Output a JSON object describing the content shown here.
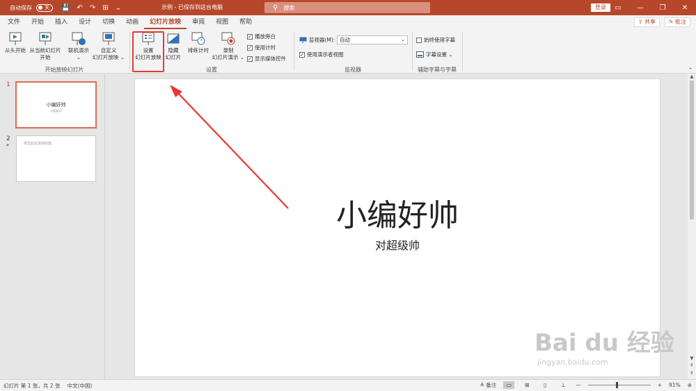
{
  "titlebar": {
    "autosave_label": "自动保存",
    "autosave_state": "关",
    "quick_access": [
      "💾",
      "↶",
      "↷",
      "⊞",
      "⌄"
    ],
    "doc_title": "示例 - 已保存到这台电脑",
    "search_placeholder": "搜索",
    "login_label": "登录",
    "window_controls": [
      "▭",
      "—",
      "❐",
      "✕"
    ],
    "accent_color": "#b7472a"
  },
  "menu": {
    "tabs": [
      "文件",
      "开始",
      "插入",
      "设计",
      "切换",
      "动画",
      "幻灯片放映",
      "审阅",
      "视图",
      "帮助"
    ],
    "active_tab": "幻灯片放映",
    "share_label": "共享",
    "comment_label": "批注"
  },
  "ribbon": {
    "start_group": {
      "label": "开始放映幻灯片",
      "from_beginning": "从头开始",
      "from_current_1": "从当前幻灯片",
      "from_current_2": "开始",
      "online_1": "联机演示",
      "online_2": "⌄",
      "custom_1": "自定义",
      "custom_2": "幻灯片放映 ⌄"
    },
    "setup_group": {
      "label": "设置",
      "setup_1": "设置",
      "setup_2": "幻灯片放映",
      "hide_1": "隐藏",
      "hide_2": "幻灯片",
      "rehearse": "排练计时",
      "record_1": "录制",
      "record_2": "幻灯片演示 ⌄",
      "play_narration": "播放旁白",
      "use_timings": "使用计时",
      "show_media": "显示媒体控件"
    },
    "monitor_group": {
      "label": "监视器",
      "monitor_label": "监视器(M):",
      "monitor_value": "自动",
      "presenter_view": "使用演示者视图"
    },
    "captions_group": {
      "label": "辅助字幕与字幕",
      "always_captions": "始终使用字幕",
      "caption_settings": "字幕设置 ⌄"
    }
  },
  "slides_panel": {
    "slide1_number": "1",
    "slide1_title": "小编好帅",
    "slide1_subtitle": "对超级帅",
    "slide2_number": "2",
    "slide2_marker": "*",
    "slide2_placeholder": "单击此处添加标题"
  },
  "slide": {
    "title": "小编好帅",
    "subtitle": "对超级帅"
  },
  "watermark": {
    "brand": "Bai du 经验",
    "url": "jingyan.baidu.com"
  },
  "statusbar": {
    "slide_info": "幻灯片 第 1 张，共 2 张",
    "language": "中文(中国)",
    "notes_label": "≜ 备注",
    "zoom_minus": "—",
    "zoom_plus": "+",
    "zoom_level": "91%"
  }
}
